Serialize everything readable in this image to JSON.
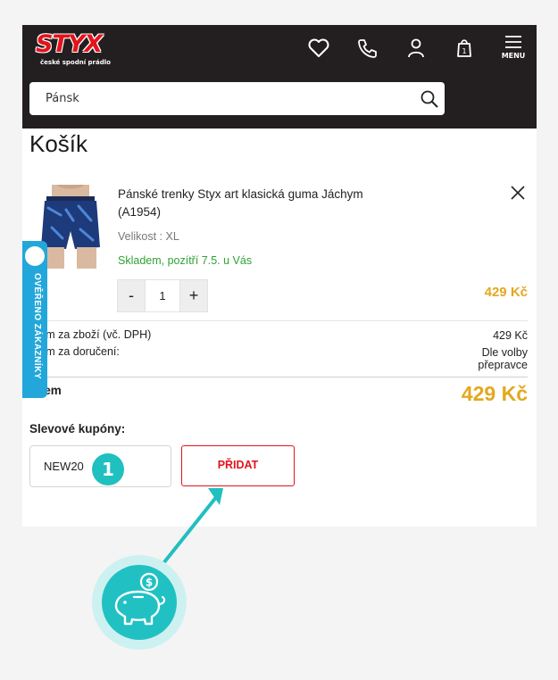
{
  "header": {
    "logo_text": "STYX",
    "logo_tagline": "české spodní prádlo",
    "icons": [
      "heart-icon",
      "phone-icon",
      "user-icon",
      "shopping-bag-icon"
    ],
    "menu_label": "MENU",
    "bag_count": "1",
    "search_value": "Pánsk"
  },
  "cart": {
    "title": "Košík",
    "item": {
      "name": "Pánské trenky Styx art klasická guma Jáchym (A1954)",
      "size": "Velikost : XL",
      "stock": "Skladem, pozítří 7.5. u Vás",
      "qty": "1",
      "qty_minus": "-",
      "qty_plus": "+",
      "price": "429 Kč"
    },
    "summary": {
      "goods_label": "kem za zboží (vč. DPH)",
      "goods_value": "429 Kč",
      "delivery_label": "kem za doručení:",
      "delivery_value_line1": "Dle volby",
      "delivery_value_line2": "přepravce",
      "total_label": "lkem",
      "total_value": "429 Kč"
    },
    "coupon": {
      "label": "Slevové kupóny:",
      "value": "NEW20",
      "button": "PŘIDAT",
      "step_number": "1"
    }
  },
  "verify_badge": {
    "text": "OVĚŘENO ZÁKAZNÍKY"
  },
  "colors": {
    "header_bg": "#231f20",
    "brand_red": "#e3131c",
    "price_gold": "#e3a81c",
    "stock_green": "#2fa233",
    "teal": "#20bfc0",
    "badge_blue": "#23a7db"
  }
}
